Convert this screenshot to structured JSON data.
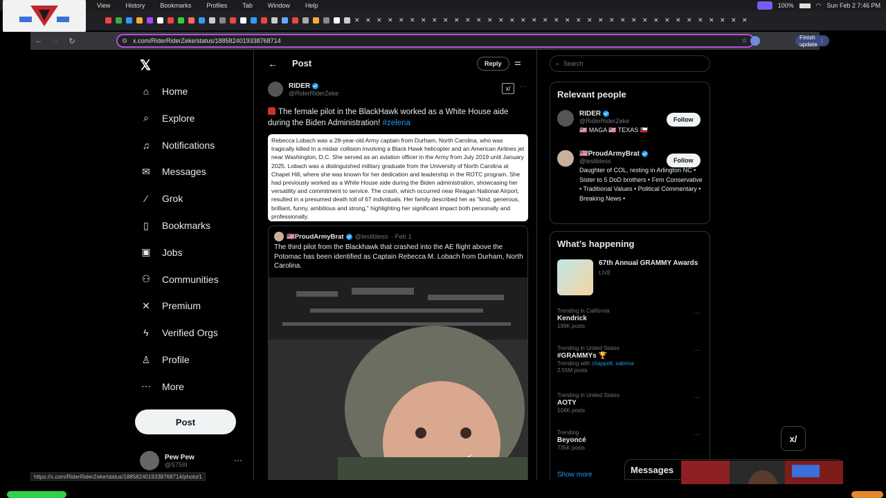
{
  "menubar": {
    "items": [
      "View",
      "History",
      "Bookmarks",
      "Profiles",
      "Tab",
      "Window",
      "Help"
    ],
    "battery": "100%",
    "datetime": "Sun Feb 2  7:46 PM"
  },
  "browser": {
    "url": "x.com/RiderRiderZeke/status/1885824019338768714",
    "finish_update": "Finish update"
  },
  "nav": {
    "items": [
      {
        "label": "Home",
        "icon": "home-icon"
      },
      {
        "label": "Explore",
        "icon": "search-icon"
      },
      {
        "label": "Notifications",
        "icon": "bell-icon"
      },
      {
        "label": "Messages",
        "icon": "envelope-icon"
      },
      {
        "label": "Grok",
        "icon": "grok-icon"
      },
      {
        "label": "Bookmarks",
        "icon": "bookmark-icon"
      },
      {
        "label": "Jobs",
        "icon": "briefcase-icon"
      },
      {
        "label": "Communities",
        "icon": "people-icon"
      },
      {
        "label": "Premium",
        "icon": "x-icon"
      },
      {
        "label": "Verified Orgs",
        "icon": "lightning-icon"
      },
      {
        "label": "Profile",
        "icon": "person-icon"
      },
      {
        "label": "More",
        "icon": "more-circle-icon"
      }
    ],
    "post_button": "Post",
    "account": {
      "name": "Pew Pew",
      "handle": "@S75III"
    }
  },
  "post": {
    "header_title": "Post",
    "reply_button": "Reply",
    "author_name": "RIDER",
    "author_handle": "@RiderRiderZeke",
    "text": "The female pilot in the BlackHawk worked as a White House aide during the Biden Administration!",
    "hashtag": "#zelena",
    "image_text": "Rebecca Lobach was a 28-year-old Army captain from Durham, North Carolina, who was tragically killed in a midair collision involving a Black Hawk helicopter and an American Airlines jet near Washington, D.C. She served as an aviation officer in the Army from July 2019 until January 2025. Lobach was a distinguished military graduate from the University of North Carolina at Chapel Hill, where she was known for her dedication and leadership in the ROTC program. She had previously worked as a White House aide during the Biden administration, showcasing her versatility and commitment to service. The crash, which occurred near Reagan National Airport, resulted in a presumed death toll of 67 individuals. Her family described her as \"kind, generous, brilliant, funny, ambitious and strong,\" highlighting her significant impact both personally and professionally.",
    "quote": {
      "name": "🇺🇸ProudArmyBrat",
      "handle": "@leslibless",
      "date": "· Feb 1",
      "text": "The third pilot from the Blackhawk that crashed into the AE flight above the Potomac has been identified as Captain Rebecca M. Lobach from Durham, North Carolina."
    }
  },
  "sidebar": {
    "search_placeholder": "Search",
    "relevant_title": "Relevant people",
    "people": [
      {
        "name": "RIDER",
        "handle": "@RiderRiderZeke",
        "bio": "🇺🇸 MAGA 🇺🇸 TEXAS 🇨🇱",
        "follow": "Follow"
      },
      {
        "name": "🇺🇸ProudArmyBrat",
        "handle": "@leslibless",
        "bio": "Daughter of COL, resting in Arlington NC • Sister to 5 DoD brothers • Firm Conservative • Traditional Values • Political Commentary • Breaking News •",
        "follow": "Follow"
      }
    ],
    "happening_title": "What’s happening",
    "event": {
      "title": "67th Annual GRAMMY Awards",
      "status": "LIVE"
    },
    "trends": [
      {
        "context": "Trending in California",
        "title": "Kendrick",
        "count": "199K posts"
      },
      {
        "context": "Trending in United States",
        "title": "#GRAMMYs",
        "count_prefix": "Trending with ",
        "links": "chappell, sabrina",
        "count": "2.55M posts"
      },
      {
        "context": "Trending in United States",
        "title": "AOTY",
        "count": "104K posts"
      },
      {
        "context": "Trending",
        "title": "Beyoncé",
        "count": "735K posts"
      }
    ],
    "show_more": "Show more"
  },
  "messages_drawer": "Messages",
  "status_url": "https://x.com/RiderRiderZeke/status/1885824019338768714/photo/1"
}
